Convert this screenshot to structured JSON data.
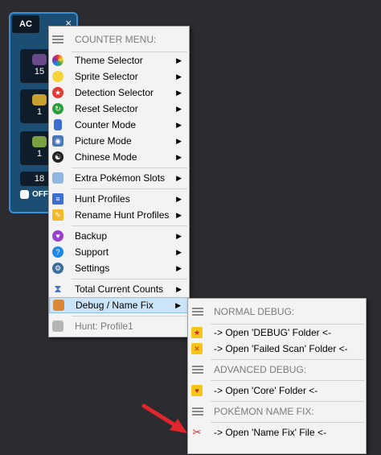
{
  "counter": {
    "tab_label": "AC",
    "close_glyph": "×",
    "slots": [
      {
        "count": "15"
      },
      {
        "count": "1"
      },
      {
        "count": "1"
      },
      {
        "count": "18"
      }
    ],
    "toggle_label": "OFF"
  },
  "main_menu": {
    "header": "COUNTER MENU:",
    "items": {
      "theme": "Theme Selector",
      "sprite": "Sprite Selector",
      "detection": "Detection Selector",
      "reset": "Reset Selector",
      "counter_mode": "Counter Mode",
      "picture_mode": "Picture Mode",
      "chinese_mode": "Chinese Mode",
      "extra_slots": "Extra Pokémon Slots",
      "hunt_profiles": "Hunt Profiles",
      "rename_profiles": "Rename Hunt Profiles",
      "backup": "Backup",
      "support": "Support",
      "settings": "Settings",
      "total_counts": "Total Current Counts",
      "debug": "Debug / Name Fix",
      "hunt_status": "Hunt: Profile1"
    },
    "submenu_arrow": "▶"
  },
  "sub_menu": {
    "normal_header": "NORMAL DEBUG:",
    "open_debug": "-> Open 'DEBUG' Folder <-",
    "open_failed": "-> Open 'Failed Scan' Folder <-",
    "advanced_header": "ADVANCED DEBUG:",
    "open_core": "-> Open 'Core' Folder <-",
    "name_fix_header": "POKÉMON NAME FIX:",
    "open_name_fix": "-> Open 'Name Fix' File <-"
  },
  "colors": {
    "background": "#2b2b30",
    "highlight": "#cce4f7",
    "pointer": "#e0262d"
  }
}
